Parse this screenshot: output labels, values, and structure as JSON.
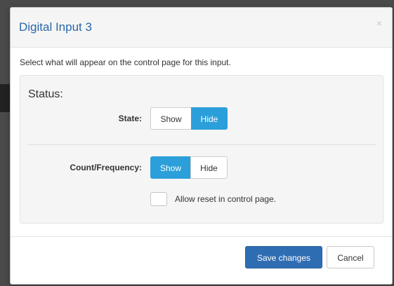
{
  "modal": {
    "title": "Digital Input 3",
    "close_symbol": "×",
    "description": "Select what will appear on the control page for this input."
  },
  "status": {
    "heading": "Status:",
    "state": {
      "label": "State:",
      "show_label": "Show",
      "hide_label": "Hide",
      "selected": "Hide"
    },
    "count_frequency": {
      "label": "Count/Frequency:",
      "show_label": "Show",
      "hide_label": "Hide",
      "selected": "Show"
    },
    "allow_reset": {
      "label": "Allow reset in control page.",
      "checked": false
    }
  },
  "footer": {
    "save_label": "Save changes",
    "cancel_label": "Cancel"
  },
  "colors": {
    "accent_active": "#2b9fd9",
    "primary": "#2f6db3",
    "title": "#2a67a8"
  },
  "icons": {
    "close": "close-icon"
  }
}
